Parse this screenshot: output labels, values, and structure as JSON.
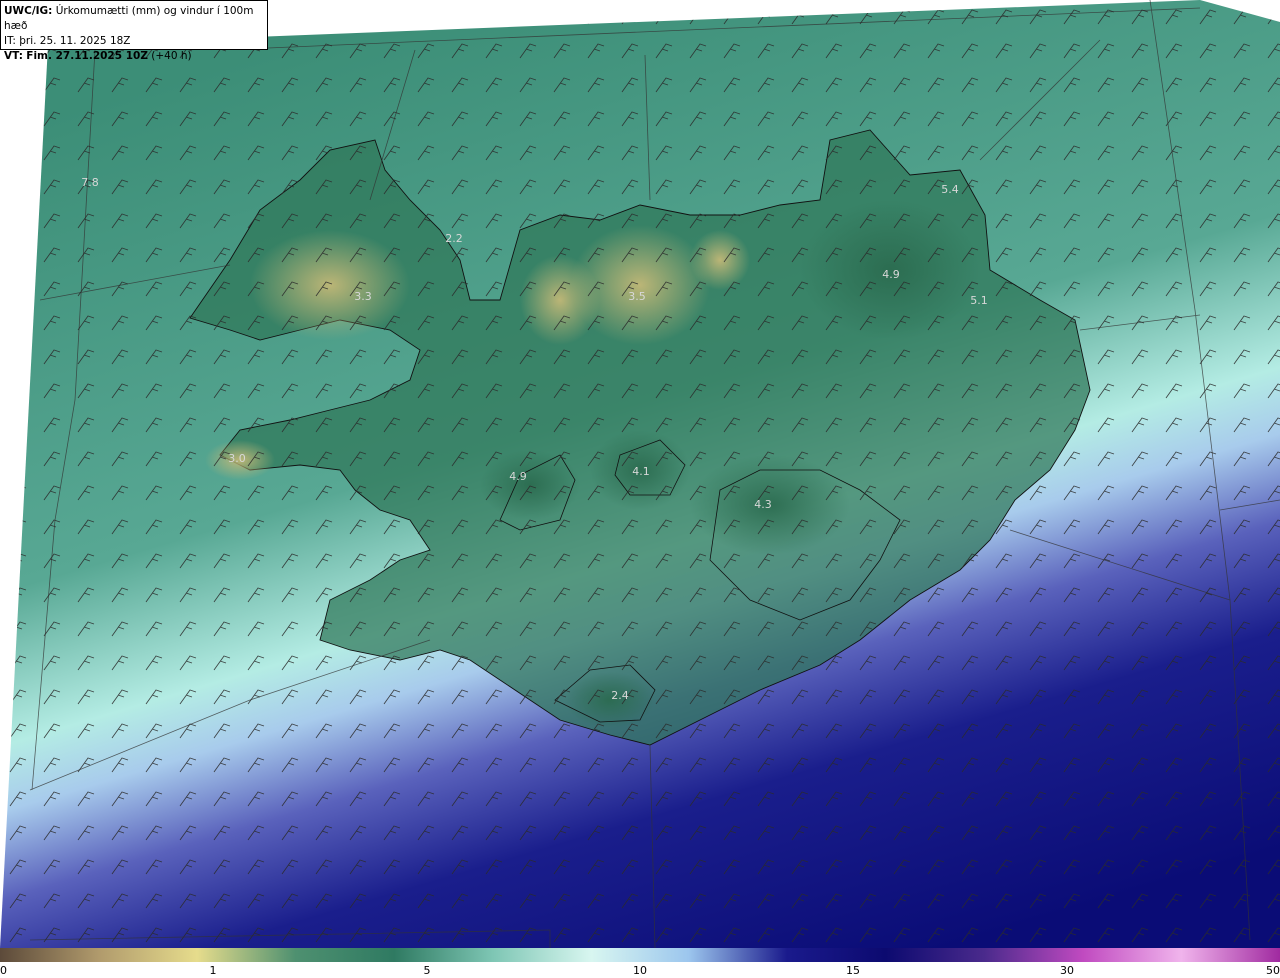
{
  "header": {
    "model_label": "UWC/IG:",
    "field_label": "Úrkomumætti (mm) og vindur í 100m hæð",
    "init_line": "IT: þri. 25. 11. 2025 18Z",
    "valid_prefix": "VT:",
    "valid_bold": "Fim. 27.11.2025 10Z",
    "valid_suffix": "(+40 h)"
  },
  "map_values": [
    "7.8",
    "2.2",
    "3.3",
    "3.5",
    "5.4",
    "4.9",
    "5.1",
    "3.0",
    "4.9",
    "4.1",
    "4.3",
    "2.4"
  ],
  "colorbar": {
    "ticks": [
      "0",
      "1",
      "5",
      "10",
      "15",
      "30",
      "50"
    ],
    "colors": [
      "#5c4a3a",
      "#b09a6c",
      "#e6dc8c",
      "#4e9070",
      "#2f7a62",
      "#7ec6b4",
      "#d8f6f0",
      "#9cc6ee",
      "#1a1a8c",
      "#0c0a70",
      "#4a2a8c",
      "#c04ac0",
      "#f0b4ec",
      "#a02aa0"
    ]
  },
  "colors": {
    "sea_green": "#3f8f78",
    "land_green": "#2f7556",
    "highland": "#b8b070",
    "light_band": "#c8f0ec",
    "deep_blue": "#0a0f78"
  }
}
